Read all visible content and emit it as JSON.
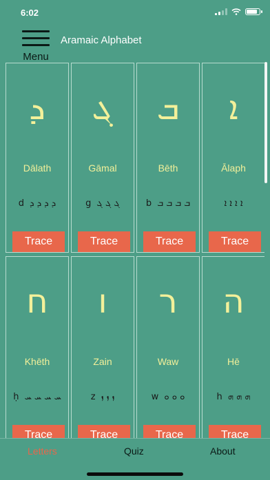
{
  "status": {
    "time": "6:02"
  },
  "header": {
    "menu_label": "Menu",
    "title": "Aramaic Alphabet"
  },
  "letters": [
    {
      "glyph": "ܕ",
      "name": "Dālath",
      "scripts": "d ܕ ܕ ܕ ܕ",
      "trace_label": "Trace"
    },
    {
      "glyph": "ܓ",
      "name": "Gāmal",
      "scripts": "g ܓ ܓ ܓ",
      "trace_label": "Trace"
    },
    {
      "glyph": "ܒ",
      "name": "Bēth",
      "scripts": "b ܒ ܒ ܒ ܒ",
      "trace_label": "Trace"
    },
    {
      "glyph": "ܐ",
      "name": "Ālaph",
      "scripts": "ܐ ܐ ܐ ܐ",
      "trace_label": "Trace"
    },
    {
      "glyph": "ח",
      "name": "Khēth",
      "scripts": "ḥ ܚ ܚ ܚ ܚ",
      "trace_label": "Trace"
    },
    {
      "glyph": "ו",
      "name": "Zain",
      "scripts": "z ܙ ܙ ܙ",
      "trace_label": "Trace"
    },
    {
      "glyph": "ר",
      "name": "Waw",
      "scripts": "w ܘ ܘ ܘ",
      "trace_label": "Trace"
    },
    {
      "glyph": "ה",
      "name": "Hē",
      "scripts": "h ܗ ܗ ܗ",
      "trace_label": "Trace"
    }
  ],
  "tabs": [
    {
      "label": "Letters",
      "active": true
    },
    {
      "label": "Quiz",
      "active": false
    },
    {
      "label": "About",
      "active": false
    }
  ],
  "colors": {
    "background": "#4d9e87",
    "letter": "#f3f09a",
    "trace_button": "#e8674b",
    "active_tab": "#e8674b"
  },
  "icons": [
    "menu-icon",
    "signal-icon",
    "wifi-icon",
    "battery-icon"
  ]
}
